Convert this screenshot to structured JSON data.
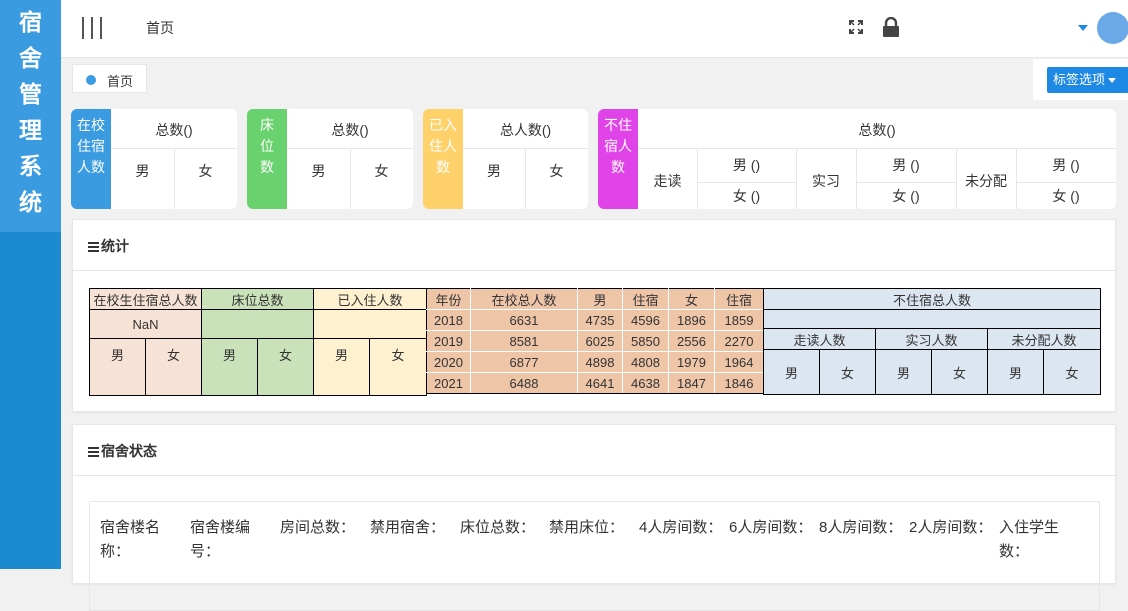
{
  "sidebar": {
    "title_chars": [
      "宿",
      "舍",
      "管",
      "理",
      "系",
      "统"
    ]
  },
  "header": {
    "home": "首页",
    "icons": [
      "menu-icon",
      "fullscreen-icon",
      "lock-icon",
      "caret-down-icon",
      "avatar"
    ]
  },
  "tabs": {
    "home_tab": "首页",
    "options": "标签选项"
  },
  "cards": {
    "c1": {
      "side": "在校住宿人数",
      "total": "总数()",
      "male": "男",
      "female": "女",
      "color": "#3a9be0"
    },
    "c2": {
      "side": "床位数",
      "total": "总数()",
      "male": "男",
      "female": "女",
      "color": "#69d26e"
    },
    "c3": {
      "side": "已入住人数",
      "total": "总人数()",
      "male": "男",
      "female": "女",
      "color": "#fed16a"
    },
    "c4": {
      "side": "不住宿人数",
      "total": "总数()",
      "c1": "走读",
      "c2": "实习",
      "c3": "未分配",
      "male": "男 ()",
      "female": "女 ()",
      "color": "#e044e8"
    }
  },
  "stats": {
    "title": "统计",
    "h_live": "在校生住宿总人数",
    "h_bed": "床位总数",
    "h_in": "已入住人数",
    "nan": "NaN",
    "male": "男",
    "female": "女",
    "years_header": [
      "年份",
      "在校总人数",
      "男",
      "住宿",
      "女",
      "住宿"
    ],
    "years": [
      [
        "2018",
        "6631",
        "4735",
        "4596",
        "1896",
        "1859"
      ],
      [
        "2019",
        "8581",
        "6025",
        "5850",
        "2556",
        "2270"
      ],
      [
        "2020",
        "6877",
        "4898",
        "4808",
        "1979",
        "1964"
      ],
      [
        "2021",
        "6488",
        "4641",
        "4638",
        "1847",
        "1846"
      ]
    ],
    "h_nolive": "不住宿总人数",
    "h_walk": "走读人数",
    "h_intern": "实习人数",
    "h_unassigned": "未分配人数",
    "colors": {
      "pink": "#f7e3d6",
      "green": "#c9e2b9",
      "yellow": "#fdf1cf",
      "salmon": "#efc5a8",
      "blue": "#dce6f1"
    }
  },
  "dorm": {
    "title": "宿舍状态",
    "columns": [
      "宿舍楼名称：",
      "宿舍楼编号：",
      "房间总数：",
      "禁用宿舍：",
      "床位总数：",
      "禁用床位：",
      "4人房间数：",
      "6人房间数：",
      "8人房间数：",
      "2人房间数：",
      "入住学生数："
    ]
  }
}
